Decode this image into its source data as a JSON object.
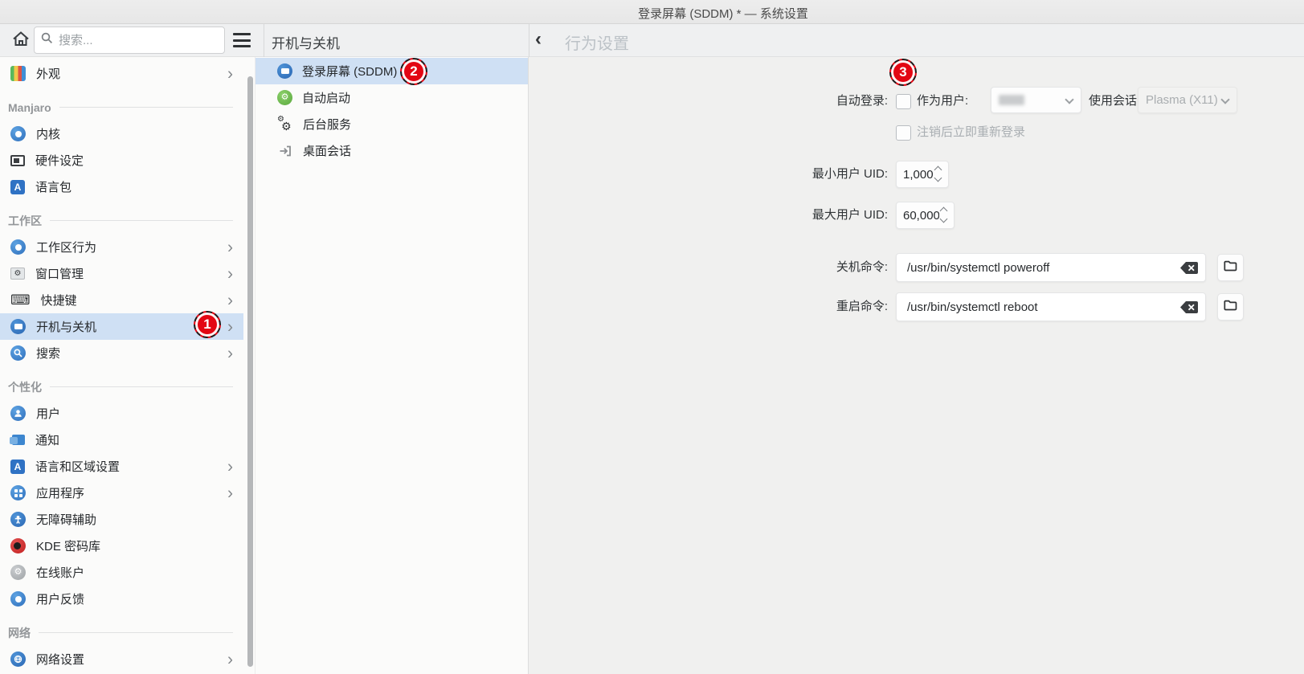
{
  "titlebar": {
    "title": "登录屏幕 (SDDM) * — 系统设置"
  },
  "toolbar": {
    "search_placeholder": "搜索..."
  },
  "sidebar": {
    "rows": [
      {
        "type": "item",
        "label": "外观",
        "chevron": true
      },
      {
        "type": "section",
        "label": "Manjaro"
      },
      {
        "type": "item",
        "label": "内核"
      },
      {
        "type": "item",
        "label": "硬件设定"
      },
      {
        "type": "item",
        "label": "语言包"
      },
      {
        "type": "section",
        "label": "工作区"
      },
      {
        "type": "item",
        "label": "工作区行为",
        "chevron": true
      },
      {
        "type": "item",
        "label": "窗口管理",
        "chevron": true
      },
      {
        "type": "item",
        "label": "快捷键",
        "chevron": true
      },
      {
        "type": "item",
        "label": "开机与关机",
        "chevron": true,
        "selected": true
      },
      {
        "type": "item",
        "label": "搜索",
        "chevron": true
      },
      {
        "type": "section",
        "label": "个性化"
      },
      {
        "type": "item",
        "label": "用户"
      },
      {
        "type": "item",
        "label": "通知"
      },
      {
        "type": "item",
        "label": "语言和区域设置",
        "chevron": true
      },
      {
        "type": "item",
        "label": "应用程序",
        "chevron": true
      },
      {
        "type": "item",
        "label": "无障碍辅助"
      },
      {
        "type": "item",
        "label": "KDE 密码库"
      },
      {
        "type": "item",
        "label": "在线账户"
      },
      {
        "type": "item",
        "label": "用户反馈"
      },
      {
        "type": "section",
        "label": "网络"
      },
      {
        "type": "item",
        "label": "网络设置",
        "chevron": true
      }
    ]
  },
  "middle": {
    "header": "开机与关机",
    "items": [
      {
        "label": "登录屏幕 (SDDM)",
        "selected": true
      },
      {
        "label": "自动启动"
      },
      {
        "label": "后台服务"
      },
      {
        "label": "桌面会话"
      }
    ]
  },
  "panel": {
    "header": "行为设置",
    "autologin_label": "自动登录:",
    "as_user_label": "作为用户:",
    "session_label": "使用会话",
    "session_value": "Plasma (X11)",
    "relogin_label": "注销后立即重新登录",
    "min_uid_label": "最小用户 UID:",
    "min_uid_value": "1,000",
    "max_uid_label": "最大用户 UID:",
    "max_uid_value": "60,000",
    "halt_label": "关机命令:",
    "halt_value": "/usr/bin/systemctl poweroff",
    "reboot_label": "重启命令:",
    "reboot_value": "/usr/bin/systemctl reboot"
  },
  "badges": {
    "step1": "1",
    "step2": "2",
    "step3": "3"
  },
  "icons": {
    "home": "house",
    "search": "magnifier",
    "menu": "hamburger",
    "back": "chevron-left",
    "row_expand": "chevron-right",
    "combo": "chevron-down",
    "clear": "backspace",
    "browse": "folder"
  },
  "colors": {
    "selection": "#cfe0f4",
    "badge_red": "#e30613",
    "panel_bg": "#f0f0ef",
    "column_bg": "#fbfbfa",
    "accent_blue": "#2e6fbc"
  }
}
